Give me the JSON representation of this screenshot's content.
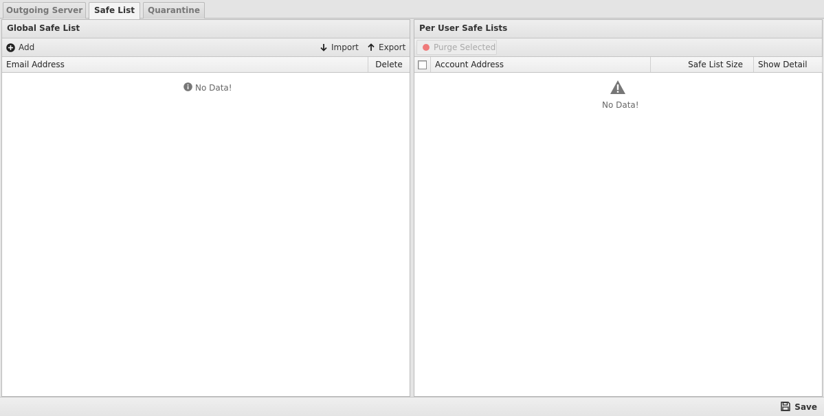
{
  "tabs": [
    {
      "label": "Outgoing Server",
      "active": false
    },
    {
      "label": "Safe List",
      "active": true
    },
    {
      "label": "Quarantine",
      "active": false
    }
  ],
  "global_panel": {
    "title": "Global Safe List",
    "toolbar": {
      "add_label": "Add",
      "import_label": "Import",
      "export_label": "Export"
    },
    "columns": [
      "Email Address",
      "Delete"
    ],
    "empty_text": "No Data!"
  },
  "user_panel": {
    "title": "Per User Safe Lists",
    "toolbar": {
      "purge_label": "Purge Selected"
    },
    "columns": [
      "Account Address",
      "Safe List Size",
      "Show Detail"
    ],
    "empty_text": "No Data!"
  },
  "footer": {
    "save_label": "Save"
  }
}
